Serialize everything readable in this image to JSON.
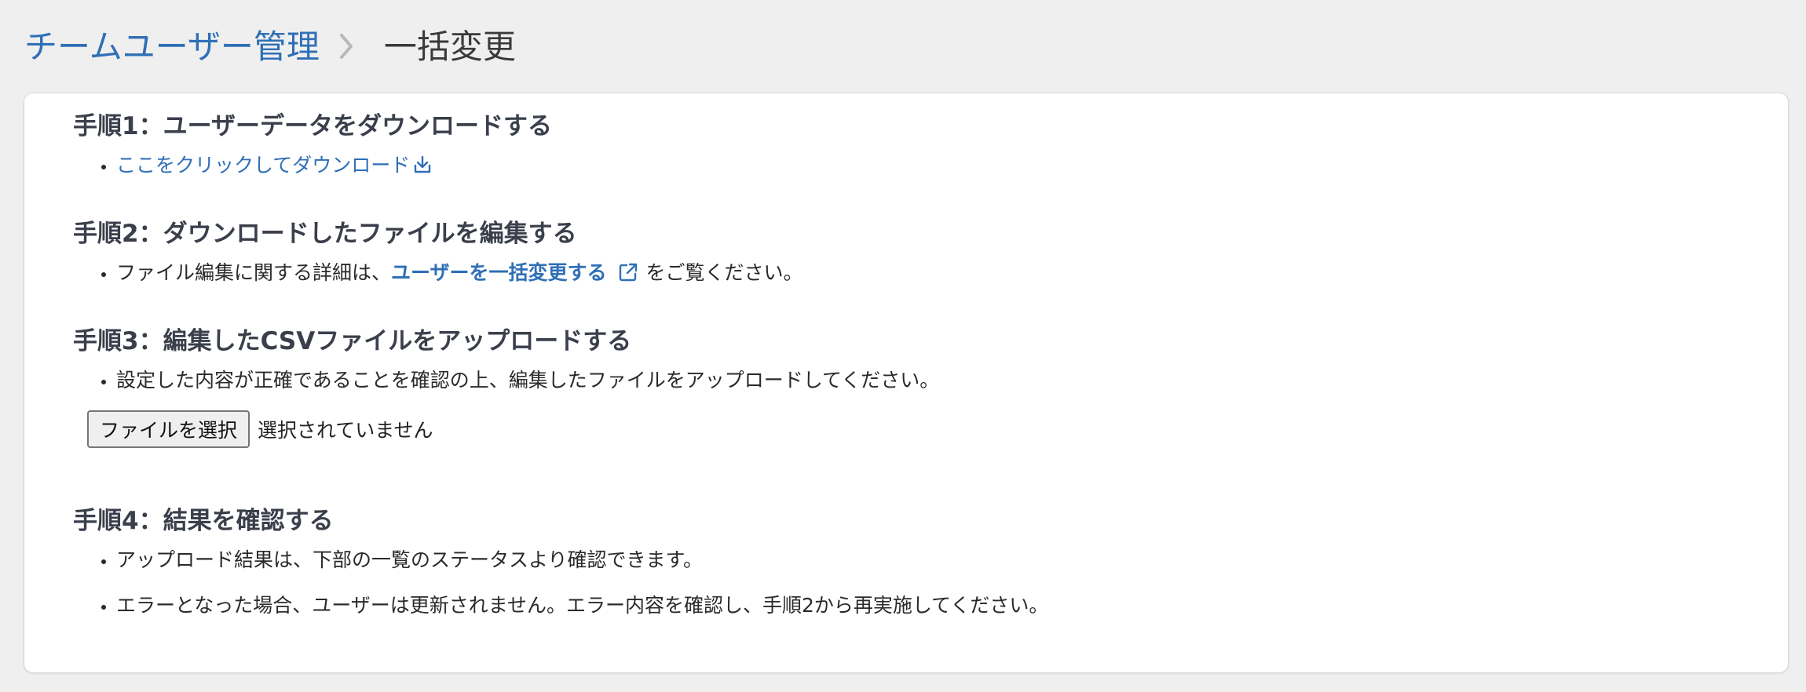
{
  "breadcrumb": {
    "parent": "チームユーザー管理",
    "current": "一括変更"
  },
  "steps": {
    "step1": {
      "title": "手順1：ユーザーデータをダウンロードする",
      "link_text": "ここをクリックしてダウンロード",
      "link_icon": "download-icon"
    },
    "step2": {
      "title": "手順2：ダウンロードしたファイルを編集する",
      "text_before": "ファイル編集に関する詳細は、",
      "link_text": "ユーザーを一括変更する",
      "link_icon": "external-link-icon",
      "text_after": "をご覧ください。"
    },
    "step3": {
      "title": "手順3：編集したCSVファイルをアップロードする",
      "text": "設定した内容が正確であることを確認の上、編集したファイルをアップロードしてください。",
      "file_button": "ファイルを選択",
      "file_status": "選択されていません"
    },
    "step4": {
      "title": "手順4：結果を確認する",
      "items": [
        "アップロード結果は、下部の一覧のステータスより確認できます。",
        "エラーとなった場合、ユーザーは更新されません。エラー内容を確認し、手順2から再実施してください。"
      ]
    }
  },
  "colors": {
    "link": "#2f6fb6",
    "background": "#efefef",
    "panel": "#ffffff",
    "heading": "#3a3f4b"
  }
}
